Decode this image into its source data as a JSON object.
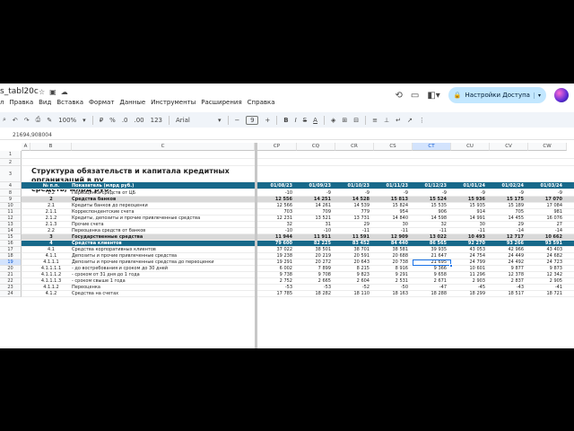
{
  "doc": {
    "title": "s_tabl20c"
  },
  "header_icons": [
    "star-icon",
    "move-to-folder-icon",
    "cloud-status-icon"
  ],
  "menu": [
    "л",
    "Правка",
    "Вид",
    "Вставка",
    "Формат",
    "Данные",
    "Инструменты",
    "Расширения",
    "Справка"
  ],
  "share": {
    "label": "Настройки Доступа"
  },
  "toolbar": {
    "zoom": "100%",
    "currency": "₽",
    "percent": "%",
    "decimal_dec": ".0",
    "decimal_inc": ".00",
    "number_fmt": "123",
    "font": "Arial",
    "font_size": "9",
    "bold": "B",
    "italic": "I",
    "strike": "S",
    "text_color": "A"
  },
  "formula": {
    "value": "21694,908004"
  },
  "sheet": {
    "title_line1": "Структура  обязательств и капитала кредитных организаций в ру",
    "title_line2": "средств, млрд руб.",
    "columns": [
      "A",
      "B",
      "C",
      "CP",
      "CQ",
      "CR",
      "CS",
      "CT",
      "CU",
      "CV",
      "CW"
    ],
    "header_row": {
      "b": "№ п.п.",
      "c": "Показатель (млрд руб.)",
      "dates": [
        "01/08/23",
        "01/09/23",
        "01/10/23",
        "01/11/23",
        "01/12/23",
        "01/01/24",
        "01/02/24",
        "01/03/24"
      ]
    },
    "rows": [
      {
        "n": "1",
        "style": "",
        "b": "",
        "c": "",
        "v": [
          "",
          "",
          "",
          "",
          "",
          "",
          "",
          ""
        ]
      },
      {
        "n": "2",
        "style": "",
        "b": "",
        "c": "",
        "v": [
          "",
          "",
          "",
          "",
          "",
          "",
          "",
          ""
        ]
      },
      {
        "n": "3",
        "style": "",
        "b": "",
        "c": "",
        "v": [
          "",
          "",
          "",
          "",
          "",
          "",
          "",
          ""
        ]
      },
      {
        "n": "4",
        "style": "blue",
        "b": "",
        "c": "",
        "v": [
          "",
          "",
          "",
          "",
          "",
          "",
          "",
          ""
        ]
      },
      {
        "n": "8",
        "style": "",
        "b": "1.2",
        "c": "Переоценка средств от ЦБ",
        "v": [
          "-10",
          "-9",
          "-9",
          "-9",
          "-9",
          "-9",
          "-9",
          "-9"
        ]
      },
      {
        "n": "9",
        "style": "grey",
        "b": "2",
        "c": "Средства банков",
        "v": [
          "12 556",
          "14 251",
          "14 528",
          "15 813",
          "15 524",
          "15 936",
          "15 175",
          "17 070"
        ]
      },
      {
        "n": "10",
        "style": "",
        "b": "2.1",
        "c": "Кредиты банков до переоценки",
        "v": [
          "12 566",
          "14 261",
          "14 539",
          "15 824",
          "15 535",
          "15 935",
          "15 189",
          "17 084"
        ]
      },
      {
        "n": "11",
        "style": "",
        "b": "2.1.1",
        "c": "Корреспондентские счета",
        "v": [
          "703",
          "709",
          "779",
          "954",
          "906",
          "914",
          "705",
          "981"
        ]
      },
      {
        "n": "12",
        "style": "",
        "b": "2.1.2",
        "c": "Кредиты, депозиты и прочие привлеченные средства",
        "v": [
          "12 231",
          "13 521",
          "13 731",
          "14 840",
          "14 598",
          "14 991",
          "14 455",
          "16 076"
        ]
      },
      {
        "n": "13",
        "style": "",
        "b": "2.1.3",
        "c": "Прочие счета",
        "v": [
          "32",
          "31",
          "29",
          "30",
          "32",
          "30",
          "29",
          "27"
        ]
      },
      {
        "n": "14",
        "style": "",
        "b": "2.2",
        "c": "Переоценка средств от банков",
        "v": [
          "-10",
          "-10",
          "-11",
          "-11",
          "-11",
          "-11",
          "-14",
          "-14"
        ]
      },
      {
        "n": "15",
        "style": "grey",
        "b": "3",
        "c": "Государственные средства",
        "v": [
          "11 944",
          "11 911",
          "11 591",
          "12 909",
          "13 022",
          "10 493",
          "12 717",
          "10 662"
        ]
      },
      {
        "n": "16",
        "style": "blue",
        "b": "4",
        "c": "Средства клиентов",
        "v": [
          "79 600",
          "82 225",
          "83 452",
          "84 440",
          "86 565",
          "92 270",
          "93 266",
          "93 591"
        ]
      },
      {
        "n": "17",
        "style": "",
        "b": "4.1",
        "c": "Средства корпоративных клиентов",
        "v": [
          "37 022",
          "38 501",
          "38 701",
          "38 581",
          "39 935",
          "43 053",
          "42 966",
          "43 403"
        ]
      },
      {
        "n": "18",
        "style": "",
        "b": "4.1.1",
        "c": "Депозиты и прочие привлеченные средства",
        "v": [
          "19 238",
          "20 219",
          "20 591",
          "20 688",
          "21 647",
          "24 754",
          "24 449",
          "24 682"
        ]
      },
      {
        "n": "19",
        "style": "",
        "b": "4.1.1.1",
        "c": "Депозиты и прочие привлеченные средства до переоценки",
        "v": [
          "19 291",
          "20 272",
          "20 643",
          "20 738",
          "21 695",
          "24 799",
          "24 492",
          "24 723"
        ]
      },
      {
        "n": "20",
        "style": "",
        "b": "4.1.1.1.1",
        "c": "- до востребования и сроком до 30 дней",
        "v": [
          "6 002",
          "7 899",
          "8 215",
          "8 916",
          "9 366",
          "10 601",
          "9 877",
          "9 873"
        ]
      },
      {
        "n": "21",
        "style": "",
        "b": "4.1.1.1.2",
        "c": "- сроком от 31 дня до 1 года",
        "v": [
          "9 738",
          "9 708",
          "9 823",
          "9 291",
          "9 658",
          "11 296",
          "12 378",
          "12 342"
        ]
      },
      {
        "n": "22",
        "style": "",
        "b": "4.1.1.1.3",
        "c": "- сроком свыше 1 года",
        "v": [
          "2 752",
          "2 665",
          "2 604",
          "2 531",
          "2 671",
          "2 903",
          "2 837",
          "2 905"
        ]
      },
      {
        "n": "23",
        "style": "",
        "b": "4.1.1.2",
        "c": "Переоценка",
        "v": [
          "-53",
          "-53",
          "-52",
          "-50",
          "-47",
          "-45",
          "-43",
          "-41"
        ]
      },
      {
        "n": "24",
        "style": "",
        "b": "4.1.2",
        "c": "Средства на счетах",
        "v": [
          "17 785",
          "18 282",
          "18 110",
          "18 163",
          "18 288",
          "18 299",
          "18 517",
          "18 721"
        ]
      }
    ]
  }
}
